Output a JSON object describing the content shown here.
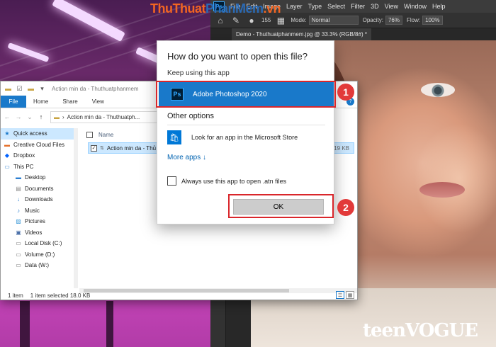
{
  "photoshop": {
    "logo": "Ps",
    "menus": [
      "File",
      "Edit",
      "Image",
      "Layer",
      "Type",
      "Select",
      "Filter",
      "3D",
      "View",
      "Window",
      "Help"
    ],
    "options": {
      "brush_size": "155",
      "mode_label": "Mode:",
      "mode_value": "Normal",
      "opacity_label": "Opacity:",
      "opacity_value": "76%",
      "flow_label": "Flow:",
      "flow_value": "100%"
    },
    "doc_tab": "Demo - Thuthuatphanmem.jpg @ 33.3% (RGB/8#) *"
  },
  "watermark": {
    "part1": "ThuThuat",
    "part2": "PhanMem",
    "part3": ".vn"
  },
  "photo_watermark": "teenVOGUE",
  "explorer": {
    "title": "Action min da - Thuthuatphanmem",
    "ribbon_tabs": [
      "File",
      "Home",
      "Share",
      "View"
    ],
    "path": "Action min da - Thuthuatph...",
    "nav": [
      {
        "label": "Quick access",
        "icon": "star-icon",
        "level": 0
      },
      {
        "label": "Creative Cloud Files",
        "icon": "cloud-icon",
        "level": 0
      },
      {
        "label": "Dropbox",
        "icon": "dropbox-icon",
        "level": 0
      },
      {
        "label": "This PC",
        "icon": "pc-icon",
        "level": 0
      },
      {
        "label": "Desktop",
        "icon": "desktop-icon",
        "level": 1
      },
      {
        "label": "Documents",
        "icon": "documents-icon",
        "level": 1
      },
      {
        "label": "Downloads",
        "icon": "downloads-icon",
        "level": 1
      },
      {
        "label": "Music",
        "icon": "music-icon",
        "level": 1
      },
      {
        "label": "Pictures",
        "icon": "pictures-icon",
        "level": 1
      },
      {
        "label": "Videos",
        "icon": "videos-icon",
        "level": 1
      },
      {
        "label": "Local Disk (C:)",
        "icon": "drive-icon",
        "level": 1
      },
      {
        "label": "Volume (D:)",
        "icon": "drive-icon",
        "level": 1
      },
      {
        "label": "Data (W:)",
        "icon": "drive-icon",
        "level": 1
      }
    ],
    "column_name": "Name",
    "file_name": "Action min da - Thủ t",
    "file_size": "19 KB",
    "status_count": "1 item",
    "status_selected": "1 item selected  18.0 KB"
  },
  "dialog": {
    "title": "How do you want to open this file?",
    "keep_label": "Keep using this app",
    "photoshop_app": "Adobe Photoshop 2020",
    "photoshop_icon": "Ps",
    "other_options": "Other options",
    "store_label": "Look for an app in the Microsoft Store",
    "more_apps": "More apps ↓",
    "always_label": "Always use this app to open .atn files",
    "ok_label": "OK"
  },
  "annotations": {
    "step1": "1",
    "step2": "2",
    "highlight_color": "#d9262b",
    "badge_color": "#e23a3a"
  },
  "colors": {
    "windows_accent": "#1979ca",
    "photoshop_blue": "#31a8ff"
  }
}
